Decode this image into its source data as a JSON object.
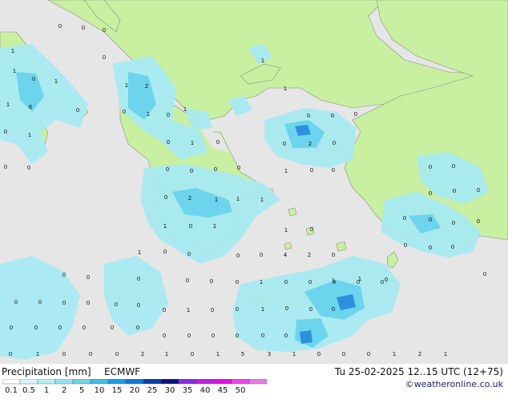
{
  "map": {
    "precip_values": [
      "1",
      "0",
      "0",
      "0",
      "0",
      "1",
      "0",
      "1",
      "1",
      "2",
      "1",
      "6",
      "0",
      "0",
      "1",
      "0",
      "1",
      "1",
      "1",
      "0",
      "0",
      "2",
      "0",
      "0",
      "0",
      "0",
      "1",
      "0",
      "0",
      "0",
      "0",
      "0",
      "2",
      "1",
      "1",
      "1",
      "1",
      "0",
      "0",
      "0",
      "1",
      "0",
      "1",
      "0",
      "0",
      "4",
      "2",
      "0",
      "1",
      "0",
      "0",
      "0",
      "1",
      "1",
      "0",
      "0",
      "0",
      "0",
      "0",
      "0",
      "0",
      "0",
      "0",
      "0",
      "0",
      "0",
      "0",
      "0",
      "0",
      "0",
      "0",
      "0",
      "0",
      "0",
      "0",
      "0",
      "1",
      "0",
      "0",
      "0",
      "0",
      "0",
      "0",
      "1",
      "1",
      "0",
      "0",
      "0",
      "1",
      "0",
      "0",
      "1",
      "0",
      "0",
      "0",
      "0",
      "0",
      "0",
      "0",
      "0",
      "0",
      "0",
      "0",
      "0",
      "0",
      "0",
      "0",
      "0",
      "0",
      "0",
      "0",
      "0",
      "1",
      "0",
      "0",
      "0",
      "2",
      "1",
      "0",
      "1",
      "5",
      "3",
      "1",
      "0",
      "0",
      "0",
      "1",
      "2",
      "1"
    ]
  },
  "footer": {
    "title": "Precipitation [mm]",
    "model": "ECMWF",
    "datetime": "Tu 25-02-2025 12..15 UTC (12+75)",
    "credit": "©weatheronline.co.uk"
  },
  "legend": {
    "ticks": [
      "0.1",
      "0.5",
      "1",
      "2",
      "5",
      "10",
      "15",
      "20",
      "25",
      "30",
      "35",
      "40",
      "45",
      "50"
    ],
    "colors": [
      "#ffffff",
      "#d8f4f8",
      "#b8eef4",
      "#94e4f0",
      "#6cd4ec",
      "#40bce6",
      "#1c9ee0",
      "#0e78d2",
      "#0a3ca6",
      "#081480",
      "#8c28e0",
      "#c020e0",
      "#e010e0",
      "#f040f0",
      "#e878e8"
    ]
  },
  "colors": {
    "sea": "#e6e6e6",
    "land": "#c8f0a0",
    "precip_light": "#a8eaf2",
    "precip_mid": "#6cd4ec",
    "precip_heavy": "#2c90dc"
  }
}
